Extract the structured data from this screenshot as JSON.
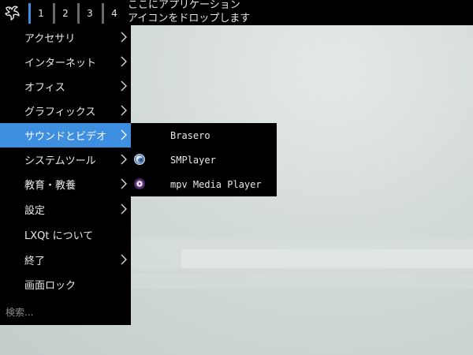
{
  "panel": {
    "desktops": [
      "1",
      "2",
      "3",
      "4"
    ],
    "active_desktop_index": 0,
    "dropzone_line1": "ここにアプリケーション",
    "dropzone_line2": "アイコンをドロップします",
    "menu_button_icon": "lxqt-logo-icon"
  },
  "menu": {
    "items": [
      {
        "label": "アクセサリ",
        "has_submenu": true
      },
      {
        "label": "インターネット",
        "has_submenu": true
      },
      {
        "label": "オフィス",
        "has_submenu": true
      },
      {
        "label": "グラフィックス",
        "has_submenu": true
      },
      {
        "label": "サウンドとビデオ",
        "has_submenu": true
      },
      {
        "label": "システムツール",
        "has_submenu": true
      },
      {
        "label": "教育・教養",
        "has_submenu": true
      },
      {
        "label": "設定",
        "has_submenu": true
      },
      {
        "label": "LXQt について",
        "has_submenu": false
      },
      {
        "label": "終了",
        "has_submenu": true
      },
      {
        "label": "画面ロック",
        "has_submenu": false
      }
    ],
    "selected_index": 4,
    "search_placeholder": "検索..."
  },
  "submenu": {
    "items": [
      {
        "label": "Brasero",
        "icon": "none"
      },
      {
        "label": "SMPlayer",
        "icon": "smplayer-icon"
      },
      {
        "label": "mpv Media Player",
        "icon": "mpv-icon"
      }
    ]
  },
  "colors": {
    "panel_bg": "#000000",
    "selection": "#3e8fe0",
    "active_desktop_marker": "#3d8ee0",
    "desktop_bg": "#c9d2cf"
  }
}
